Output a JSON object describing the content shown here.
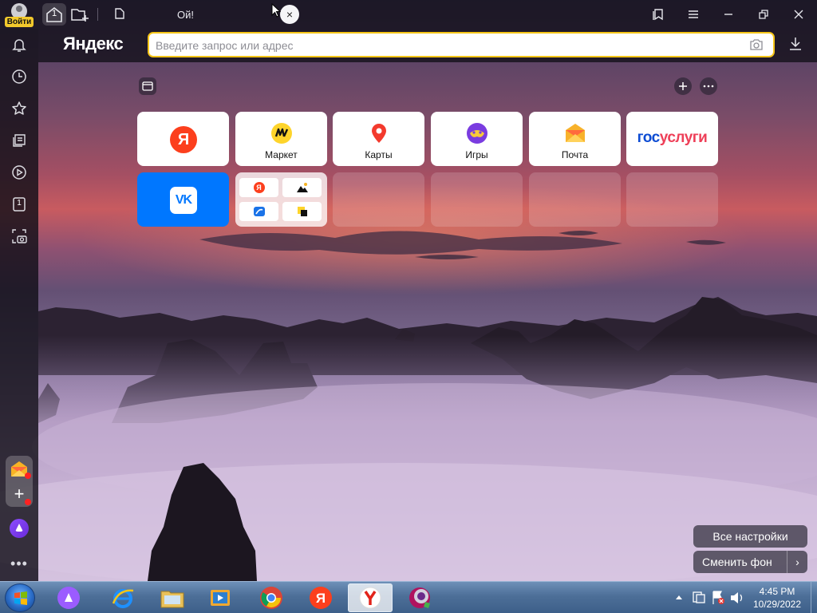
{
  "titlebar": {
    "login_label": "Войти",
    "home_tab_count": "1",
    "active_tab_title": "Ой!",
    "close_tab_glyph": "×"
  },
  "addressbar": {
    "logo": "Яндекс",
    "placeholder": "Введите запрос или адрес"
  },
  "sidebar": {
    "tabs_count": "1",
    "more": "•••"
  },
  "tiles": [
    {
      "id": "yandex",
      "label": "",
      "glyph": "Я"
    },
    {
      "id": "market",
      "label": "Маркет"
    },
    {
      "id": "maps",
      "label": "Карты"
    },
    {
      "id": "games",
      "label": "Игры"
    },
    {
      "id": "mail",
      "label": "Почта"
    },
    {
      "id": "gosuslugi",
      "label": "",
      "logo_part1": "гос",
      "logo_part2": "услуги"
    },
    {
      "id": "vk",
      "label": "",
      "glyph": "VK"
    },
    {
      "id": "folder",
      "label": ""
    }
  ],
  "bottom_buttons": {
    "all_settings": "Все настройки",
    "change_background": "Сменить фон",
    "change_background_arrow": "›"
  },
  "taskbar": {
    "time": "4:45 PM",
    "date": "10/29/2022"
  },
  "colors": {
    "accent_yellow": "#f5c518",
    "yandex_red": "#fc3f1d",
    "vk_blue": "#0077ff",
    "gos_blue": "#0d4cd3",
    "gos_red": "#ee3f58"
  }
}
